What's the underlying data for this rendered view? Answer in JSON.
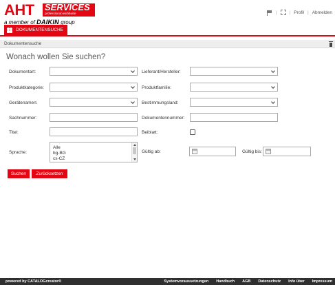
{
  "brand": {
    "name": "AHT",
    "services": "SERVICES",
    "services_sub": "professional.worldwide",
    "tagline_prefix": "a member of",
    "tagline_brand": "DAIKIN",
    "tagline_suffix": "group"
  },
  "topnav": {
    "profile": "Profil",
    "logout": "Abmelden",
    "separator": "|"
  },
  "tabs": [
    {
      "label": "DOKUMENTENSUCHE",
      "icon": "people-icon",
      "active": true
    }
  ],
  "breadcrumb": "Dokumentensuche",
  "page_title": "Wonach wollen Sie suchen?",
  "form": {
    "document_type": {
      "label": "Dokumentart:",
      "value": ""
    },
    "supplier": {
      "label": "Lieferant/Hersteller:",
      "value": ""
    },
    "product_category": {
      "label": "Produktkategorie:",
      "value": ""
    },
    "product_family": {
      "label": "Produktfamilie:",
      "value": ""
    },
    "device_name": {
      "label": "Gerätenamen:",
      "value": ""
    },
    "destination_country": {
      "label": "Bestimmungsland:",
      "value": ""
    },
    "item_number": {
      "label": "Sachnummer:",
      "value": ""
    },
    "document_number": {
      "label": "Dokumentennummer:",
      "value": ""
    },
    "title": {
      "label": "Titel:",
      "value": ""
    },
    "supplement": {
      "label": "Beiblatt:",
      "checked": false
    },
    "language": {
      "label": "Sprache:",
      "options": [
        "Alle",
        "bg-BG",
        "cs-CZ"
      ]
    },
    "valid_from": {
      "label": "Gültig ab:",
      "value": ""
    },
    "valid_to": {
      "label": "Gültig bis:",
      "value": ""
    }
  },
  "buttons": {
    "search": "Suchen",
    "reset": "Zurücksetzen"
  },
  "footer": {
    "powered_by": "powered by CATALOGcreator®",
    "links": [
      "Systemvoraussetzungen",
      "Handbuch",
      "AGB",
      "Datenschutz",
      "Info über",
      "Impressum"
    ]
  },
  "colors": {
    "accent": "#e30613",
    "footer_bg": "#2f2f2f",
    "breadcrumb_bg": "#eeeeee"
  }
}
